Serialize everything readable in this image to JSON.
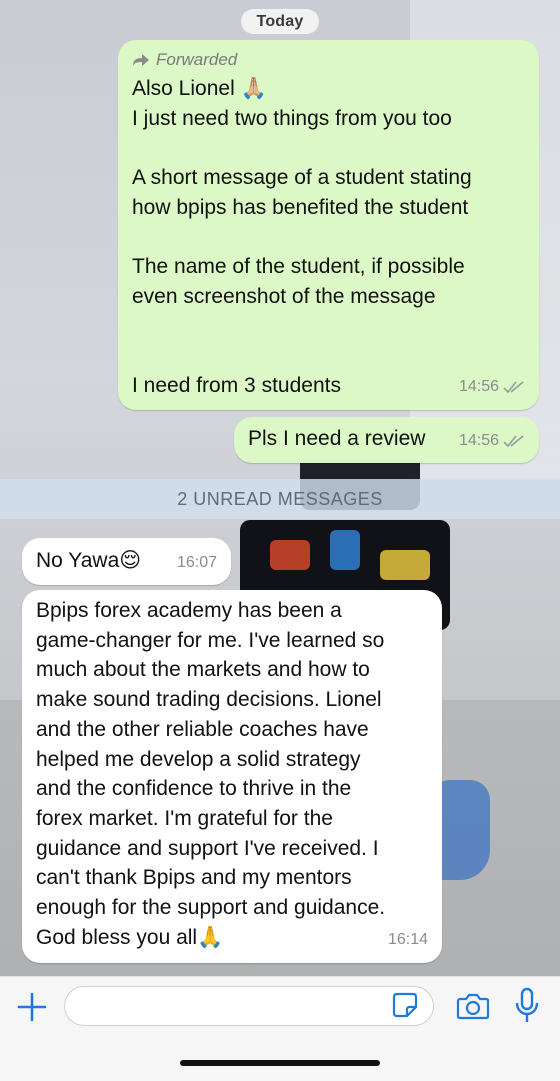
{
  "header": {
    "date_label": "Today"
  },
  "messages_out": {
    "forwarded_label": "Forwarded",
    "m1": {
      "line1": "Also Lionel 🙏🏼",
      "line2": "I just need two things from you too",
      "line3": "A short message of a student stating",
      "line4": "how bpips has benefited the student",
      "line5": "The name of the student, if possible",
      "line6": "even screenshot of the message",
      "line7": "I need from 3 students",
      "time": "14:56"
    },
    "m2": {
      "text": "Pls I need a review",
      "time": "14:56"
    }
  },
  "unread": {
    "label": "2 UNREAD MESSAGES"
  },
  "messages_in": {
    "m3": {
      "text": "No Yawa😌",
      "time": "16:07"
    },
    "m4": {
      "lines": [
        "Bpips forex academy has been a",
        "game-changer for me. I've learned so",
        "much about the markets and how to",
        "make sound trading decisions. Lionel",
        "and the other reliable coaches have",
        "helped me develop a solid strategy",
        "and the confidence to thrive in the",
        "forex market. I'm grateful for the",
        "guidance and support I've received. I",
        "can't thank Bpips and my mentors",
        "enough for the support and guidance.",
        "God bless you all🙏"
      ],
      "time": "16:14"
    }
  },
  "composer": {
    "input_placeholder": "",
    "icons": [
      "plus-icon",
      "sticker-icon",
      "camera-icon",
      "microphone-icon"
    ]
  },
  "colors": {
    "outgoing_bubble": "#dbf8c6",
    "incoming_bubble": "#ffffff",
    "accent": "#1f7ae0"
  }
}
